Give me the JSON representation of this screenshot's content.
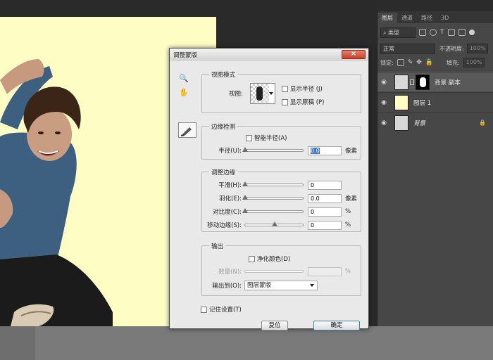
{
  "layers_panel": {
    "tabs": [
      "图层",
      "通道",
      "路径",
      "3D"
    ],
    "filter_kind": "类型",
    "blend_mode": "正常",
    "opacity_label": "不透明度:",
    "opacity_value": "100%",
    "lock_label": "锁定:",
    "fill_label": "填充:",
    "fill_value": "100%",
    "layers": [
      {
        "name": "背景 副本",
        "selected": true,
        "has_mask": true
      },
      {
        "name": "图层 1",
        "selected": false,
        "has_mask": false
      },
      {
        "name": "背景",
        "selected": false,
        "locked": true
      }
    ]
  },
  "dialog": {
    "title": "调整蒙版",
    "close_glyph": "×",
    "view_mode": {
      "group_title": "视图模式",
      "view_label": "视图:",
      "show_radius": "显示半径 (J)",
      "show_original": "显示原稿 (P)"
    },
    "edge_detection": {
      "group_title": "边缘检测",
      "smart_radius": "智能半径(A)",
      "radius_label": "半径(U):",
      "radius_value": "0.0",
      "radius_unit": "像素"
    },
    "adjust_edge": {
      "group_title": "调整边缘",
      "smooth_label": "平滑(H):",
      "smooth_value": "0",
      "feather_label": "羽化(E):",
      "feather_value": "0.0",
      "feather_unit": "像素",
      "contrast_label": "对比度(C):",
      "contrast_value": "0",
      "contrast_unit": "%",
      "shift_label": "移动边缘(S):",
      "shift_value": "0",
      "shift_unit": "%"
    },
    "output": {
      "group_title": "输出",
      "decontaminate": "净化颜色(D)",
      "amount_label": "数量(N):",
      "amount_unit": "%",
      "output_to_label": "输出到(O):",
      "output_to_value": "图层蒙版"
    },
    "remember": "记住设置(T)",
    "reset_button": "复位",
    "ok_button": "确定"
  }
}
